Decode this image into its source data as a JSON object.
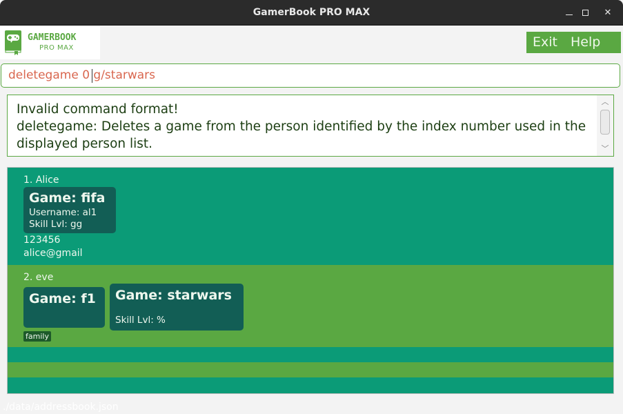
{
  "window": {
    "title": "GamerBook PRO MAX",
    "controls": {
      "minimize": "minimize",
      "maximize": "maximize",
      "close": "✕"
    }
  },
  "logo": {
    "line1": "GAMERBOOK",
    "line2": "PRO MAX"
  },
  "menu": {
    "exit": "Exit",
    "help": "Help"
  },
  "command": {
    "value": "deletegame 0 g/starwars",
    "placeholder": ""
  },
  "result": {
    "text": "Invalid command format!\ndeletegame: Deletes a game from the person identified by the index number used in the displayed person list."
  },
  "persons": [
    {
      "index_name": "1. Alice",
      "games": [
        {
          "title": "Game: fifa",
          "username": "Username: al1",
          "skill": "Skill Lvl: gg"
        }
      ],
      "phone": "123456",
      "email": "alice@gmail",
      "tags": []
    },
    {
      "index_name": "2. eve",
      "games": [
        {
          "title": "Game: f1"
        },
        {
          "title": "Game: starwars",
          "skill": "Skill Lvl: %"
        }
      ],
      "tags": [
        "family"
      ]
    }
  ],
  "status_bar": {
    "path": "./data/addressbook.json"
  },
  "colors": {
    "accent_green": "#5aa842",
    "accent_teal": "#0b9b77",
    "game_card": "#125e55",
    "command_text": "#d9674f",
    "result_text": "#1c3e12"
  }
}
